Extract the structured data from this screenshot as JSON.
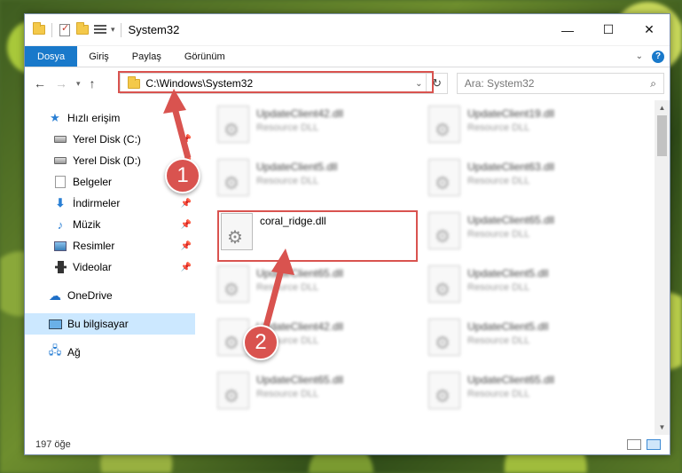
{
  "window": {
    "title": "System32"
  },
  "ribbon": {
    "tabs": [
      "Dosya",
      "Giriş",
      "Paylaş",
      "Görünüm"
    ]
  },
  "address": {
    "path": "C:\\Windows\\System32"
  },
  "search": {
    "placeholder": "Ara: System32"
  },
  "sidebar": {
    "quick_access": "Hızlı erişim",
    "items": [
      {
        "label": "Yerel Disk (C:)"
      },
      {
        "label": "Yerel Disk (D:)"
      },
      {
        "label": "Belgeler"
      },
      {
        "label": "İndirmeler"
      },
      {
        "label": "Müzik"
      },
      {
        "label": "Resimler"
      },
      {
        "label": "Videolar"
      }
    ],
    "onedrive": "OneDrive",
    "this_pc": "Bu bilgisayar",
    "network": "Ağ"
  },
  "files": [
    {
      "name": "UpdateClient42.dll",
      "type": "Resource DLL"
    },
    {
      "name": "UpdateClient19.dll",
      "type": "Resource DLL"
    },
    {
      "name": "UpdateClient5.dll",
      "type": "Resource DLL"
    },
    {
      "name": "UpdateClient63.dll",
      "type": "Resource DLL"
    },
    {
      "name": "coral_ridge.dll",
      "type": ""
    },
    {
      "name": "UpdateClient65.dll",
      "type": "Resource DLL"
    },
    {
      "name": "UpdateClient65.dll",
      "type": "Resource DLL"
    },
    {
      "name": "UpdateClient5.dll",
      "type": "Resource DLL"
    },
    {
      "name": "UpdateClient42.dll",
      "type": "Resource DLL"
    },
    {
      "name": "UpdateClient5.dll",
      "type": "Resource DLL"
    },
    {
      "name": "UpdateClient65.dll",
      "type": "Resource DLL"
    },
    {
      "name": "UpdateClient65.dll",
      "type": "Resource DLL"
    }
  ],
  "status": {
    "count": "197 öğe"
  },
  "annotations": {
    "step1": "1",
    "step2": "2",
    "color": "#d9534f"
  }
}
